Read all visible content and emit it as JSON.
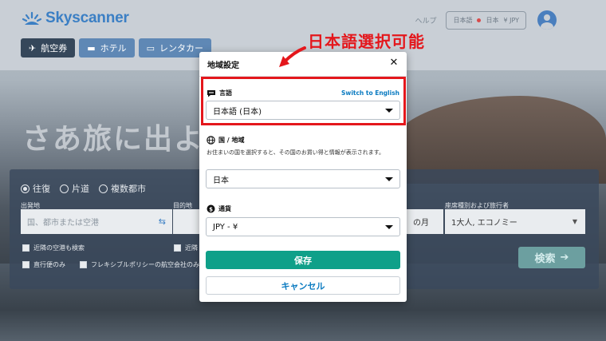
{
  "brand": {
    "name": "Skyscanner",
    "color": "#3b7fc4"
  },
  "header": {
    "help": "ヘルプ",
    "locale": {
      "language": "日本語",
      "region": "日本",
      "currency": "¥ JPY"
    }
  },
  "nav": {
    "tabs": [
      {
        "label": "航空券",
        "icon": "airplane-icon",
        "active": true
      },
      {
        "label": "ホテル",
        "icon": "bed-icon",
        "active": false
      },
      {
        "label": "レンタカー",
        "icon": "car-icon",
        "active": false
      }
    ]
  },
  "hero": {
    "text": "さあ旅に出よ"
  },
  "search": {
    "trip_types": [
      "往復",
      "片道",
      "複数都市"
    ],
    "selected_trip": "往復",
    "from_label": "出発地",
    "to_label": "目的地",
    "from_placeholder": "国、都市または空港",
    "return_value": "の月",
    "travelers_label": "座席種別および旅行者",
    "travelers_value": "1大人, エコノミー",
    "nearby_airports": "近隣の空港も検索",
    "nearby_airports_2": "近隣",
    "direct_only": "直行便のみ",
    "flexible_policy": "フレキシブルポリシーの航空会社のみ",
    "search_button": "検索"
  },
  "modal": {
    "title": "地域設定",
    "language": {
      "label": "言語",
      "switch_link": "Switch to English",
      "value": "日本語 (日本)"
    },
    "region": {
      "label": "国 / 地域",
      "description": "お住まいの国を選択すると、その国のお買い得と情報が表示されます。",
      "value": "日本"
    },
    "currency": {
      "label": "通貨",
      "value": "JPY - ¥"
    },
    "save_button": "保存",
    "cancel_button": "キャンセル",
    "accent_color": "#0fa089"
  },
  "annotation": {
    "text": "日本語選択可能",
    "color": "#e4171c"
  }
}
